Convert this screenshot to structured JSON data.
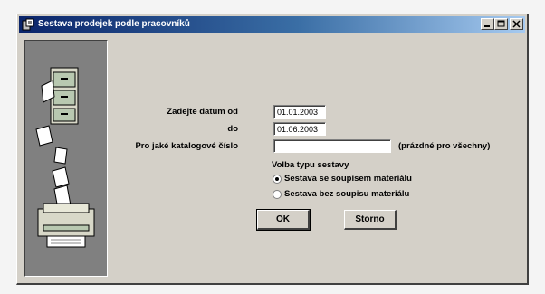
{
  "window": {
    "title": "Sestava prodejek podle pracovníků"
  },
  "form": {
    "date_from_label": "Zadejte datum od",
    "date_from_value": "01.01.2003",
    "date_to_label": "do",
    "date_to_value": "01.06.2003",
    "catalog_label": "Pro jaké katalogové číslo",
    "catalog_value": "",
    "catalog_hint": "(prázdné pro všechny)",
    "report_type_heading": "Volba typu sestavy",
    "report_types": [
      {
        "label": "Sestava se soupisem materiálu",
        "checked": true
      },
      {
        "label": "Sestava bez soupisu materiálu",
        "checked": false
      }
    ]
  },
  "buttons": {
    "ok_label": "OK",
    "cancel_label": "Storno"
  },
  "icons": {
    "title_icon": "app-icon",
    "minimize": "minimize-icon",
    "maximize": "maximize-icon",
    "close": "close-icon",
    "illustration": "filing-cabinet-printer-illustration"
  }
}
